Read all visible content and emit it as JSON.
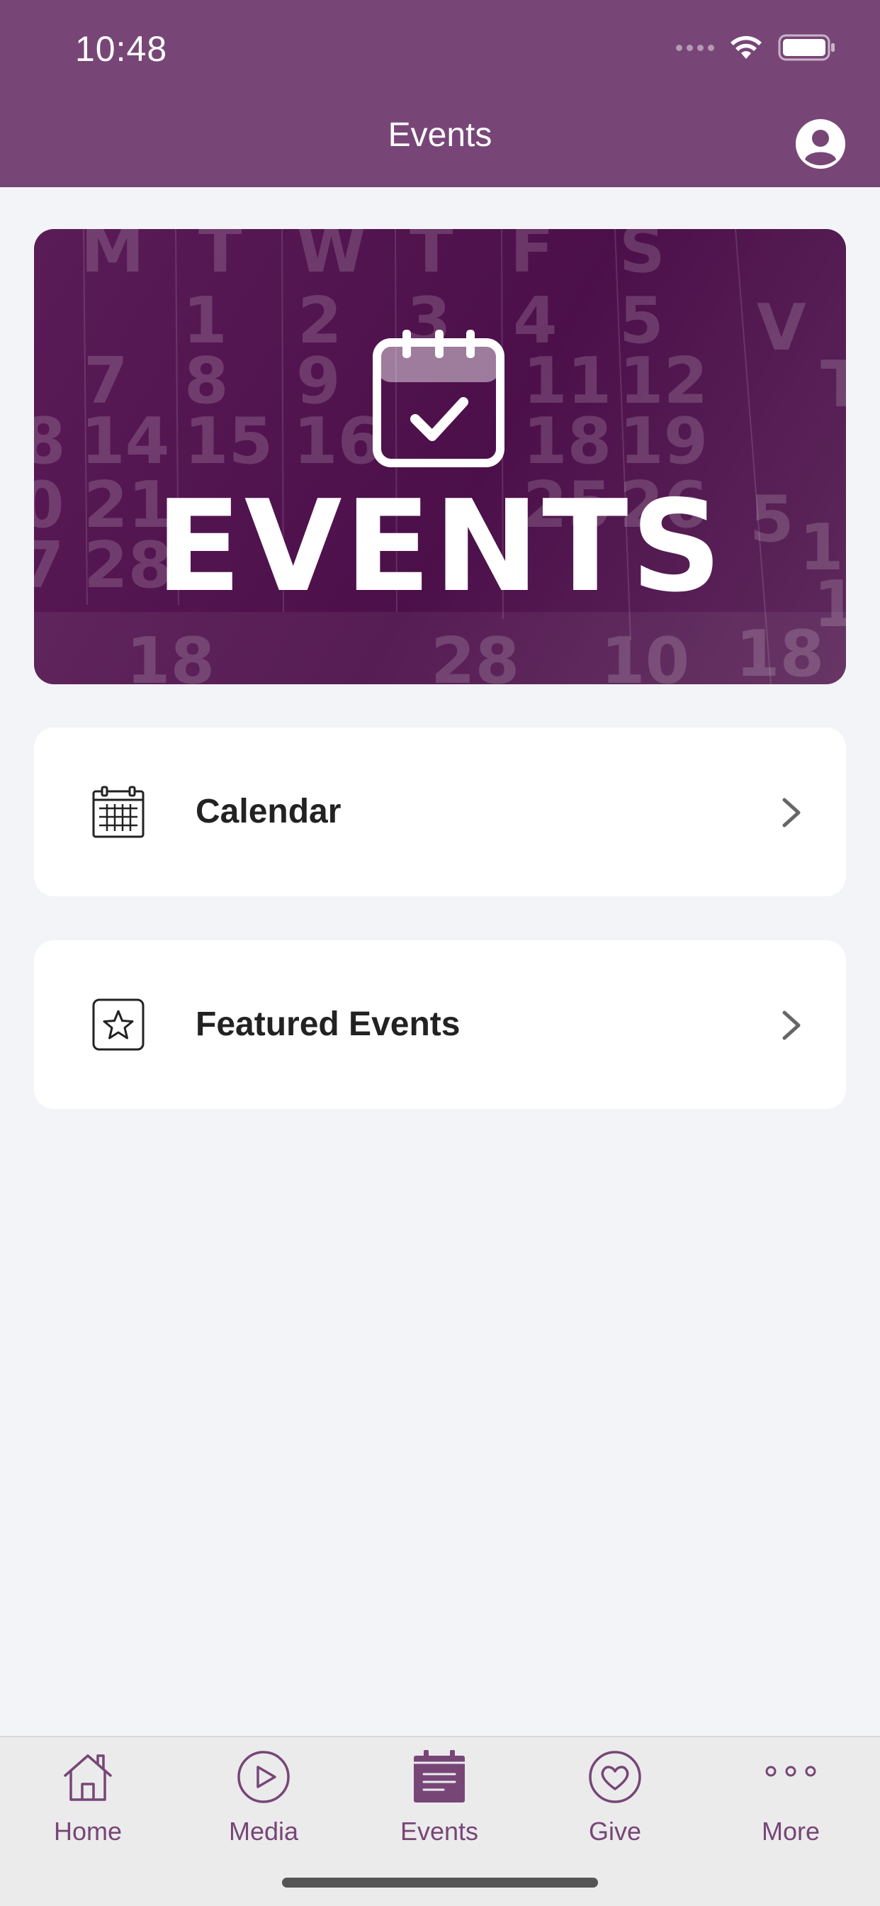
{
  "status_bar": {
    "time": "10:48"
  },
  "header": {
    "title": "Events"
  },
  "banner": {
    "word": "EVENTS"
  },
  "menu": [
    {
      "label": "Calendar",
      "icon": "calendar-grid-icon"
    },
    {
      "label": "Featured Events",
      "icon": "star-square-icon"
    }
  ],
  "tabs": [
    {
      "label": "Home",
      "icon": "home-icon"
    },
    {
      "label": "Media",
      "icon": "play-circle-icon"
    },
    {
      "label": "Events",
      "icon": "events-calendar-icon",
      "selected": true
    },
    {
      "label": "Give",
      "icon": "heart-circle-icon"
    },
    {
      "label": "More",
      "icon": "more-dots-icon"
    }
  ],
  "colors": {
    "brand": "#774677",
    "background": "#f3f4f8",
    "card": "#ffffff",
    "tabbar": "#ebebeb"
  }
}
